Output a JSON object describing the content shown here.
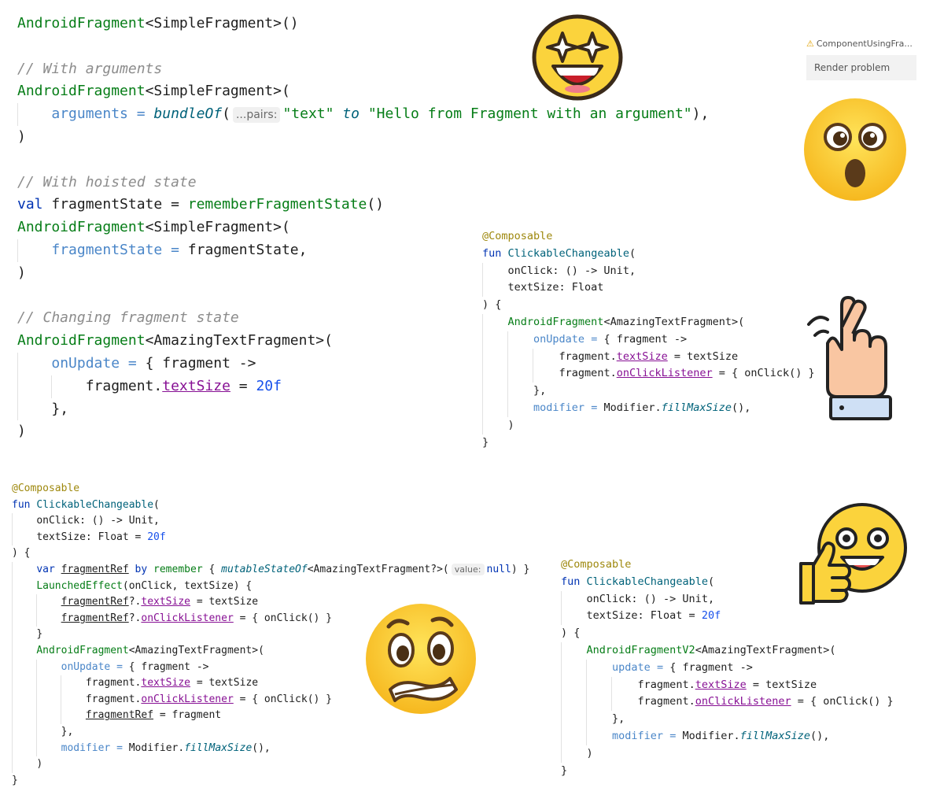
{
  "render_widget": {
    "tab_label": "ComponentUsingFra...",
    "problem_label": "Render problem"
  },
  "code_a": {
    "l1_fn": "AndroidFragment",
    "l1_rest": "<SimpleFragment>()",
    "l3": "// With arguments",
    "l4_fn": "AndroidFragment",
    "l4_rest": "<SimpleFragment>(",
    "l5_param": "arguments",
    "l5_eq": " = ",
    "l5_call": "bundleOf",
    "l5_paren": "(",
    "l5_hint": "...pairs:",
    "l5_s1": "\"text\"",
    "l5_to": " to ",
    "l5_s2": "\"Hello from Fragment with an argument\"",
    "l5_end": "),",
    "l6": ")",
    "l8": "// With hoisted state",
    "l9_kw": "val",
    "l9_mid": " fragmentState = ",
    "l9_fn": "rememberFragmentState",
    "l9_end": "()",
    "l10_fn": "AndroidFragment",
    "l10_rest": "<SimpleFragment>(",
    "l11_param": "fragmentState",
    "l11_eq": " = ",
    "l11_rest": "fragmentState,",
    "l12": ")",
    "l14": "// Changing fragment state",
    "l15_fn": "AndroidFragment",
    "l15_rest": "<AmazingTextFragment>(",
    "l16_param": "onUpdate",
    "l16_eq": " = ",
    "l16_rest": "{ fragment ->",
    "l17_pre": "fragment.",
    "l17_prop": "textSize",
    "l17_eq": " = ",
    "l17_num": "20f",
    "l18": "},",
    "l19": ")"
  },
  "code_b": {
    "l1": "@Composable",
    "l2_kw": "fun",
    "l2_fn": "ClickableChangeable",
    "l2_end": "(",
    "l3": "onClick: () -> Unit,",
    "l4": "textSize: Float",
    "l5": ") {",
    "l6_fn": "AndroidFragment",
    "l6_rest": "<AmazingTextFragment>(",
    "l7_param": "onUpdate",
    "l7_eq": " = ",
    "l7_rest": "{ fragment ->",
    "l8_pre": "fragment.",
    "l8_prop": "textSize",
    "l8_rest": " = textSize",
    "l9_pre": "fragment.",
    "l9_prop": "onClickListener",
    "l9_rest": " = { onClick() }",
    "l10": "},",
    "l11_param": "modifier",
    "l11_eq": " = ",
    "l11_pre": "Modifier.",
    "l11_fn": "fillMaxSize",
    "l11_end": "(),",
    "l12": ")",
    "l13": "}"
  },
  "code_c": {
    "l1": "@Composable",
    "l2_kw": "fun",
    "l2_fn": "ClickableChangeable",
    "l2_end": "(",
    "l3": "onClick: () -> Unit,",
    "l4_pre": "textSize: Float = ",
    "l4_num": "20f",
    "l5": ") {",
    "l6_kw": "var",
    "l6_ref": "fragmentRef",
    "l6_by": " by ",
    "l6_fn": "remember",
    "l6_open": " { ",
    "l6_call": "mutableStateOf",
    "l6_type": "<AmazingTextFragment?>(",
    "l6_hint": "value:",
    "l6_null": "null",
    "l6_end": ") }",
    "l7_fn": "LaunchedEffect",
    "l7_rest": "(onClick, textSize) {",
    "l8_ref": "fragmentRef",
    "l8_q": "?.",
    "l8_prop": "textSize",
    "l8_rest": " = textSize",
    "l9_ref": "fragmentRef",
    "l9_q": "?.",
    "l9_prop": "onClickListener",
    "l9_rest": " = { onClick() }",
    "l10": "}",
    "l11_fn": "AndroidFragment",
    "l11_rest": "<AmazingTextFragment>(",
    "l12_param": "onUpdate",
    "l12_eq": " = ",
    "l12_rest": "{ fragment ->",
    "l13_pre": "fragment.",
    "l13_prop": "textSize",
    "l13_rest": " = textSize",
    "l14_pre": "fragment.",
    "l14_prop": "onClickListener",
    "l14_rest": " = { onClick() }",
    "l15_ref": "fragmentRef",
    "l15_rest": " = fragment",
    "l16": "},",
    "l17_param": "modifier",
    "l17_eq": " = ",
    "l17_pre": "Modifier.",
    "l17_fn": "fillMaxSize",
    "l17_end": "(),",
    "l18": ")",
    "l19": "}"
  },
  "code_d": {
    "l1": "@Composable",
    "l2_kw": "fun",
    "l2_fn": "ClickableChangeable",
    "l2_end": "(",
    "l3": "onClick: () -> Unit,",
    "l4_pre": "textSize: Float = ",
    "l4_num": "20f",
    "l5": ") {",
    "l6_fn": "AndroidFragmentV2",
    "l6_rest": "<AmazingTextFragment>(",
    "l7_param": "update",
    "l7_eq": " = ",
    "l7_rest": "{ fragment ->",
    "l8_pre": "fragment.",
    "l8_prop": "textSize",
    "l8_rest": " = textSize",
    "l9_pre": "fragment.",
    "l9_prop": "onClickListener",
    "l9_rest": " = { onClick() }",
    "l10": "},",
    "l11_param": "modifier",
    "l11_eq": " = ",
    "l11_pre": "Modifier.",
    "l11_fn": "fillMaxSize",
    "l11_end": "(),",
    "l12": ")",
    "l13": "}"
  },
  "emojis": {
    "star_struck": "star-struck-emoji",
    "surprised": "surprised-emoji",
    "crossed_fingers": "crossed-fingers-hand",
    "grimacing": "grimacing-emoji",
    "thumbs_up": "thumbs-up-emoji"
  },
  "colors": {
    "emoji_yellow": "#fbd33c",
    "emoji_outline": "#3a2a1a",
    "comment": "#8c8c8c",
    "keyword": "#0033b3",
    "function": "#067d17",
    "parameter": "#4a86c8",
    "property": "#871094",
    "number": "#1750eb",
    "annotation": "#9e880d"
  }
}
